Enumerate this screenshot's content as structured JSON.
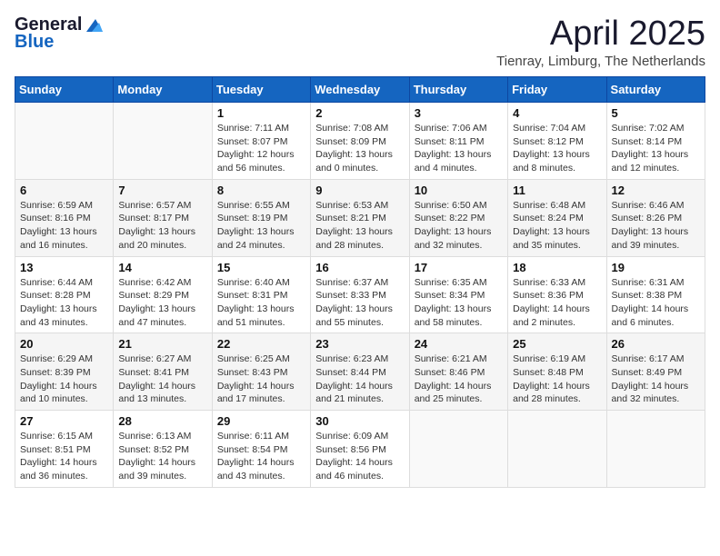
{
  "header": {
    "logo_general": "General",
    "logo_blue": "Blue",
    "title": "April 2025",
    "subtitle": "Tienray, Limburg, The Netherlands"
  },
  "weekdays": [
    "Sunday",
    "Monday",
    "Tuesday",
    "Wednesday",
    "Thursday",
    "Friday",
    "Saturday"
  ],
  "weeks": [
    [
      {
        "day": "",
        "content": ""
      },
      {
        "day": "",
        "content": ""
      },
      {
        "day": "1",
        "content": "Sunrise: 7:11 AM\nSunset: 8:07 PM\nDaylight: 12 hours and 56 minutes."
      },
      {
        "day": "2",
        "content": "Sunrise: 7:08 AM\nSunset: 8:09 PM\nDaylight: 13 hours and 0 minutes."
      },
      {
        "day": "3",
        "content": "Sunrise: 7:06 AM\nSunset: 8:11 PM\nDaylight: 13 hours and 4 minutes."
      },
      {
        "day": "4",
        "content": "Sunrise: 7:04 AM\nSunset: 8:12 PM\nDaylight: 13 hours and 8 minutes."
      },
      {
        "day": "5",
        "content": "Sunrise: 7:02 AM\nSunset: 8:14 PM\nDaylight: 13 hours and 12 minutes."
      }
    ],
    [
      {
        "day": "6",
        "content": "Sunrise: 6:59 AM\nSunset: 8:16 PM\nDaylight: 13 hours and 16 minutes."
      },
      {
        "day": "7",
        "content": "Sunrise: 6:57 AM\nSunset: 8:17 PM\nDaylight: 13 hours and 20 minutes."
      },
      {
        "day": "8",
        "content": "Sunrise: 6:55 AM\nSunset: 8:19 PM\nDaylight: 13 hours and 24 minutes."
      },
      {
        "day": "9",
        "content": "Sunrise: 6:53 AM\nSunset: 8:21 PM\nDaylight: 13 hours and 28 minutes."
      },
      {
        "day": "10",
        "content": "Sunrise: 6:50 AM\nSunset: 8:22 PM\nDaylight: 13 hours and 32 minutes."
      },
      {
        "day": "11",
        "content": "Sunrise: 6:48 AM\nSunset: 8:24 PM\nDaylight: 13 hours and 35 minutes."
      },
      {
        "day": "12",
        "content": "Sunrise: 6:46 AM\nSunset: 8:26 PM\nDaylight: 13 hours and 39 minutes."
      }
    ],
    [
      {
        "day": "13",
        "content": "Sunrise: 6:44 AM\nSunset: 8:28 PM\nDaylight: 13 hours and 43 minutes."
      },
      {
        "day": "14",
        "content": "Sunrise: 6:42 AM\nSunset: 8:29 PM\nDaylight: 13 hours and 47 minutes."
      },
      {
        "day": "15",
        "content": "Sunrise: 6:40 AM\nSunset: 8:31 PM\nDaylight: 13 hours and 51 minutes."
      },
      {
        "day": "16",
        "content": "Sunrise: 6:37 AM\nSunset: 8:33 PM\nDaylight: 13 hours and 55 minutes."
      },
      {
        "day": "17",
        "content": "Sunrise: 6:35 AM\nSunset: 8:34 PM\nDaylight: 13 hours and 58 minutes."
      },
      {
        "day": "18",
        "content": "Sunrise: 6:33 AM\nSunset: 8:36 PM\nDaylight: 14 hours and 2 minutes."
      },
      {
        "day": "19",
        "content": "Sunrise: 6:31 AM\nSunset: 8:38 PM\nDaylight: 14 hours and 6 minutes."
      }
    ],
    [
      {
        "day": "20",
        "content": "Sunrise: 6:29 AM\nSunset: 8:39 PM\nDaylight: 14 hours and 10 minutes."
      },
      {
        "day": "21",
        "content": "Sunrise: 6:27 AM\nSunset: 8:41 PM\nDaylight: 14 hours and 13 minutes."
      },
      {
        "day": "22",
        "content": "Sunrise: 6:25 AM\nSunset: 8:43 PM\nDaylight: 14 hours and 17 minutes."
      },
      {
        "day": "23",
        "content": "Sunrise: 6:23 AM\nSunset: 8:44 PM\nDaylight: 14 hours and 21 minutes."
      },
      {
        "day": "24",
        "content": "Sunrise: 6:21 AM\nSunset: 8:46 PM\nDaylight: 14 hours and 25 minutes."
      },
      {
        "day": "25",
        "content": "Sunrise: 6:19 AM\nSunset: 8:48 PM\nDaylight: 14 hours and 28 minutes."
      },
      {
        "day": "26",
        "content": "Sunrise: 6:17 AM\nSunset: 8:49 PM\nDaylight: 14 hours and 32 minutes."
      }
    ],
    [
      {
        "day": "27",
        "content": "Sunrise: 6:15 AM\nSunset: 8:51 PM\nDaylight: 14 hours and 36 minutes."
      },
      {
        "day": "28",
        "content": "Sunrise: 6:13 AM\nSunset: 8:52 PM\nDaylight: 14 hours and 39 minutes."
      },
      {
        "day": "29",
        "content": "Sunrise: 6:11 AM\nSunset: 8:54 PM\nDaylight: 14 hours and 43 minutes."
      },
      {
        "day": "30",
        "content": "Sunrise: 6:09 AM\nSunset: 8:56 PM\nDaylight: 14 hours and 46 minutes."
      },
      {
        "day": "",
        "content": ""
      },
      {
        "day": "",
        "content": ""
      },
      {
        "day": "",
        "content": ""
      }
    ]
  ]
}
